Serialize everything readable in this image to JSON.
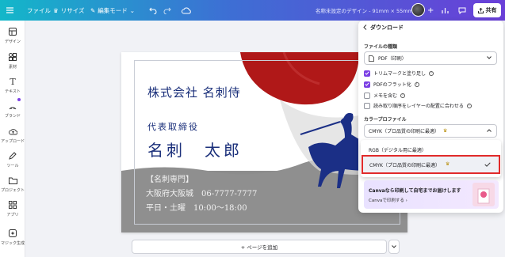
{
  "topbar": {
    "file": "ファイル",
    "resize": "リサイズ",
    "edit_mode": "編集モード",
    "doc_title": "名称未設定のデザイン - 91mm × 55mm",
    "share": "共有"
  },
  "sidebar": {
    "items": [
      {
        "label": "デザイン",
        "icon": "layout-icon"
      },
      {
        "label": "素材",
        "icon": "shapes-icon"
      },
      {
        "label": "テキスト",
        "icon": "text-icon"
      },
      {
        "label": "ブランド",
        "icon": "brand-icon"
      },
      {
        "label": "アップロード",
        "icon": "upload-icon"
      },
      {
        "label": "ツール",
        "icon": "pen-icon"
      },
      {
        "label": "プロジェクト",
        "icon": "folder-icon"
      },
      {
        "label": "アプリ",
        "icon": "apps-icon"
      },
      {
        "label": "マジック生成",
        "icon": "magic-icon"
      }
    ]
  },
  "card": {
    "company": "株式会社 名刺侍",
    "role": "代表取締役",
    "name": "名刺　太郎",
    "address_line1": "【名刺専門】",
    "address_line2": "大阪府大阪城　06-7777-7777",
    "address_line3": "平日・土曜　10:00～18:00"
  },
  "canvas": {
    "add_page": "+ ページを追加"
  },
  "panel": {
    "title": "ダウンロード",
    "file_type_label": "ファイルの種類",
    "file_type_value": "PDF（印刷）",
    "options": [
      {
        "label": "トリムマークと塗り足し",
        "checked": true
      },
      {
        "label": "PDFのフラット化",
        "checked": true
      },
      {
        "label": "メモを含む",
        "checked": false
      },
      {
        "label": "読み取り順序をレイヤーの配置に合わせる",
        "checked": false
      }
    ],
    "color_profile_label": "カラープロファイル",
    "color_profile_value": "CMYK（プロ品質の印刷に最適）",
    "dropdown_options": [
      "RGB（デジタル用に最適）",
      "CMYK（プロ品質の印刷に最適）"
    ],
    "promo_title": "Canvaなら印刷して自宅までお届けします",
    "promo_link": "Canvaで印刷する"
  },
  "colors": {
    "accent": "#7b3fe4",
    "highlight": "#e12a2a",
    "card_navy": "#1a2f7a",
    "sun_red": "#b01818"
  }
}
